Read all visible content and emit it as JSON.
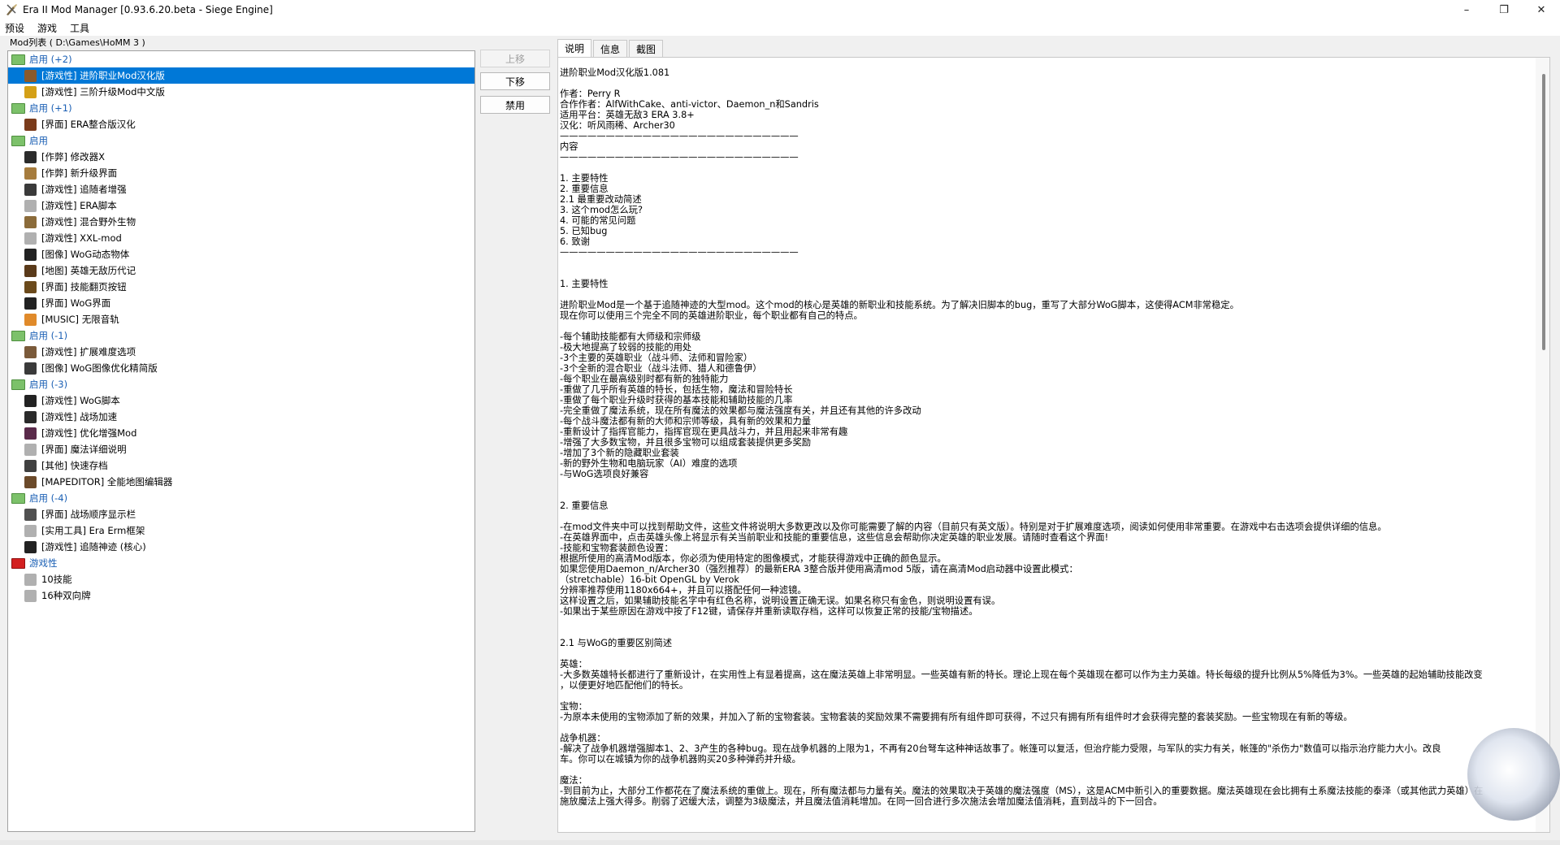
{
  "window": {
    "title": "Era II Mod Manager [0.93.6.20.beta - Siege Engine]",
    "controls": [
      "–",
      "❐",
      "✕"
    ]
  },
  "menu": [
    "预设",
    "游戏",
    "工具"
  ],
  "modlist": {
    "label": "Mod列表 ( D:\\Games\\HoMM 3 )",
    "rows": [
      {
        "kind": "group",
        "label": "启用 (+2)",
        "folder": "green"
      },
      {
        "kind": "item",
        "label": "[游戏性] 进阶职业Mod汉化版",
        "icon": "#8a5a2b",
        "selected": true
      },
      {
        "kind": "item",
        "label": "[游戏性] 三阶升级Mod中文版",
        "icon": "#d4a017"
      },
      {
        "kind": "group",
        "label": "启用 (+1)",
        "folder": "green"
      },
      {
        "kind": "item",
        "label": "[界面] ERA整合版汉化",
        "icon": "#7a3b1b"
      },
      {
        "kind": "group",
        "label": "启用",
        "folder": "green"
      },
      {
        "kind": "item",
        "label": "[作弊] 修改器X",
        "icon": "#2b2b2b"
      },
      {
        "kind": "item",
        "label": "[作弊] 新升级界面",
        "icon": "#a67c3d"
      },
      {
        "kind": "item",
        "label": "[游戏性] 追随者增强",
        "icon": "#3a3a3a"
      },
      {
        "kind": "item",
        "label": "[游戏性] ERA脚本",
        "icon": "#b0b0b0"
      },
      {
        "kind": "item",
        "label": "[游戏性] 混合野外生物",
        "icon": "#8b6b3a"
      },
      {
        "kind": "item",
        "label": "[游戏性] XXL-mod",
        "icon": "#b0b0b0"
      },
      {
        "kind": "item",
        "label": "[图像] WoG动态物体",
        "icon": "#222222"
      },
      {
        "kind": "item",
        "label": "[地图] 英雄无敌历代记",
        "icon": "#5a3a1a"
      },
      {
        "kind": "item",
        "label": "[界面] 技能翻页按钮",
        "icon": "#6b4a1b"
      },
      {
        "kind": "item",
        "label": "[界面] WoG界面",
        "icon": "#222222"
      },
      {
        "kind": "item",
        "label": "[MUSIC] 无限音轨",
        "icon": "#e08a2a"
      },
      {
        "kind": "group",
        "label": "启用 (-1)",
        "folder": "green"
      },
      {
        "kind": "item",
        "label": "[游戏性] 扩展难度选项",
        "icon": "#7a5a3a"
      },
      {
        "kind": "item",
        "label": "[图像] WoG图像优化精简版",
        "icon": "#3a3a3a"
      },
      {
        "kind": "group",
        "label": "启用 (-3)",
        "folder": "green"
      },
      {
        "kind": "item",
        "label": "[游戏性] WoG脚本",
        "icon": "#222222"
      },
      {
        "kind": "item",
        "label": "[游戏性] 战场加速",
        "icon": "#2a2a2a"
      },
      {
        "kind": "item",
        "label": "[游戏性] 优化增强Mod",
        "icon": "#5a2a4a"
      },
      {
        "kind": "item",
        "label": "[界面] 魔法详细说明",
        "icon": "#b0b0b0"
      },
      {
        "kind": "item",
        "label": "[其他] 快速存档",
        "icon": "#404040"
      },
      {
        "kind": "item",
        "label": "[MAPEDITOR] 全能地图编辑器",
        "icon": "#6b4a2a"
      },
      {
        "kind": "group",
        "label": "启用 (-4)",
        "folder": "green"
      },
      {
        "kind": "item",
        "label": "[界面] 战场顺序显示栏",
        "icon": "#505050"
      },
      {
        "kind": "item",
        "label": "[实用工具] Era Erm框架",
        "icon": "#b0b0b0"
      },
      {
        "kind": "item",
        "label": "[游戏性] 追随神迹 (核心)",
        "icon": "#222222"
      },
      {
        "kind": "group",
        "label": "游戏性",
        "folder": "red"
      },
      {
        "kind": "item",
        "label": "10技能",
        "icon": "#b0b0b0"
      },
      {
        "kind": "item",
        "label": "16种双向牌",
        "icon": "#b0b0b0"
      }
    ]
  },
  "buttons": {
    "move_up": "上移",
    "move_down": "下移",
    "disable": "禁用"
  },
  "tabs": [
    "说明",
    "信息",
    "截图"
  ],
  "description": [
    "进阶职业Mod汉化版1.081",
    "",
    "作者：Perry R",
    "合作作者：AlfWithCake、anti-victor、Daemon_n和Sandris",
    "适用平台：英雄无敌3 ERA 3.8+",
    "汉化：听风雨稀、Archer30",
    "——————————————————————————",
    "内容",
    "——————————————————————————",
    "",
    "1. 主要特性",
    "2. 重要信息",
    "2.1 最重要改动简述",
    "3. 这个mod怎么玩?",
    "4. 可能的常见问题",
    "5. 已知bug",
    "6. 致谢",
    "——————————————————————————",
    "",
    "",
    "1. 主要特性",
    "",
    "进阶职业Mod是一个基于追随神迹的大型mod。这个mod的核心是英雄的新职业和技能系统。为了解决旧脚本的bug，重写了大部分WoG脚本，这使得ACM非常稳定。",
    "现在你可以使用三个完全不同的英雄进阶职业，每个职业都有自己的特点。",
    "",
    "-每个辅助技能都有大师级和宗师级",
    "-极大地提高了较弱的技能的用处",
    "-3个主要的英雄职业（战斗师、法师和冒险家）",
    "-3个全新的混合职业（战斗法师、猎人和德鲁伊）",
    "-每个职业在最高级别时都有新的独特能力",
    "-重做了几乎所有英雄的特长，包括生物，魔法和冒险特长",
    "-重做了每个职业升级时获得的基本技能和辅助技能的几率",
    "-完全重做了魔法系统，现在所有魔法的效果都与魔法强度有关，并且还有其他的许多改动",
    "-每个战斗魔法都有新的大师和宗师等级，具有新的效果和力量",
    "-重新设计了指挥官能力，指挥官现在更具战斗力，并且用起来非常有趣",
    "-增强了大多数宝物，并且很多宝物可以组成套装提供更多奖励",
    "-增加了3个新的隐藏职业套装",
    "-新的野外生物和电脑玩家（AI）难度的选项",
    "-与WoG选项良好兼容",
    "",
    "",
    "2. 重要信息",
    "",
    "-在mod文件夹中可以找到帮助文件，这些文件将说明大多数更改以及你可能需要了解的内容（目前只有英文版）。特别是对于扩展难度选项，阅读如何使用非常重要。在游戏中右击选项会提供详细的信息。",
    "-在英雄界面中，点击英雄头像上将显示有关当前职业和技能的重要信息，这些信息会帮助你决定英雄的职业发展。请随时查看这个界面!",
    "-技能和宝物套装颜色设置：",
    "根据所使用的高清Mod版本，你必须为使用特定的图像模式，才能获得游戏中正确的颜色显示。",
    "如果您使用Daemon_n/Archer30（强烈推荐）的最新ERA 3整合版并使用高清mod 5版，请在高清Mod启动器中设置此模式：",
    "（stretchable）16-bit OpenGL by Verok",
    "分辨率推荐使用1180x664+，并且可以搭配任何一种滤镜。",
    "这样设置之后，如果辅助技能名字中有红色名称，说明设置正确无误。如果名称只有金色，则说明设置有误。",
    "-如果出于某些原因在游戏中按了F12键，请保存并重新读取存档，这样可以恢复正常的技能/宝物描述。",
    "",
    "",
    "2.1 与WoG的重要区别简述",
    "",
    "英雄：",
    "-大多数英雄特长都进行了重新设计，在实用性上有显着提高，这在魔法英雄上非常明显。一些英雄有新的特长。理论上现在每个英雄现在都可以作为主力英雄。特长每级的提升比例从5%降低为3%。一些英雄的起始辅助技能改变",
    "，以便更好地匹配他们的特长。",
    "",
    "宝物：",
    "-为原本未使用的宝物添加了新的效果，并加入了新的宝物套装。宝物套装的奖励效果不需要拥有所有组件即可获得，不过只有拥有所有组件时才会获得完整的套装奖励。一些宝物现在有新的等级。",
    "",
    "战争机器：",
    "-解决了战争机器增强脚本1、2、3产生的各种bug。现在战争机器的上限为1，不再有20台弩车这种神话故事了。帐篷可以复活，但治疗能力受限，与军队的实力有关，帐篷的\"杀伤力\"数值可以指示治疗能力大小。改良",
    "车。你可以在城镇为你的战争机器购买20多种弹药并升级。",
    "",
    "魔法：",
    "-到目前为止，大部分工作都花在了魔法系统的重做上。现在，所有魔法都与力量有关。魔法的效果取决于英雄的魔法强度（MS），这是ACM中新引入的重要数据。魔法英雄现在会比拥有土系魔法技能的泰泽（或其他武力英雄）在",
    "施放魔法上强大得多。削弱了迟缓大法，调整为3级魔法，并且魔法值消耗增加。在同一回合进行多次施法会增加魔法值消耗，直到战斗的下一回合。"
  ]
}
